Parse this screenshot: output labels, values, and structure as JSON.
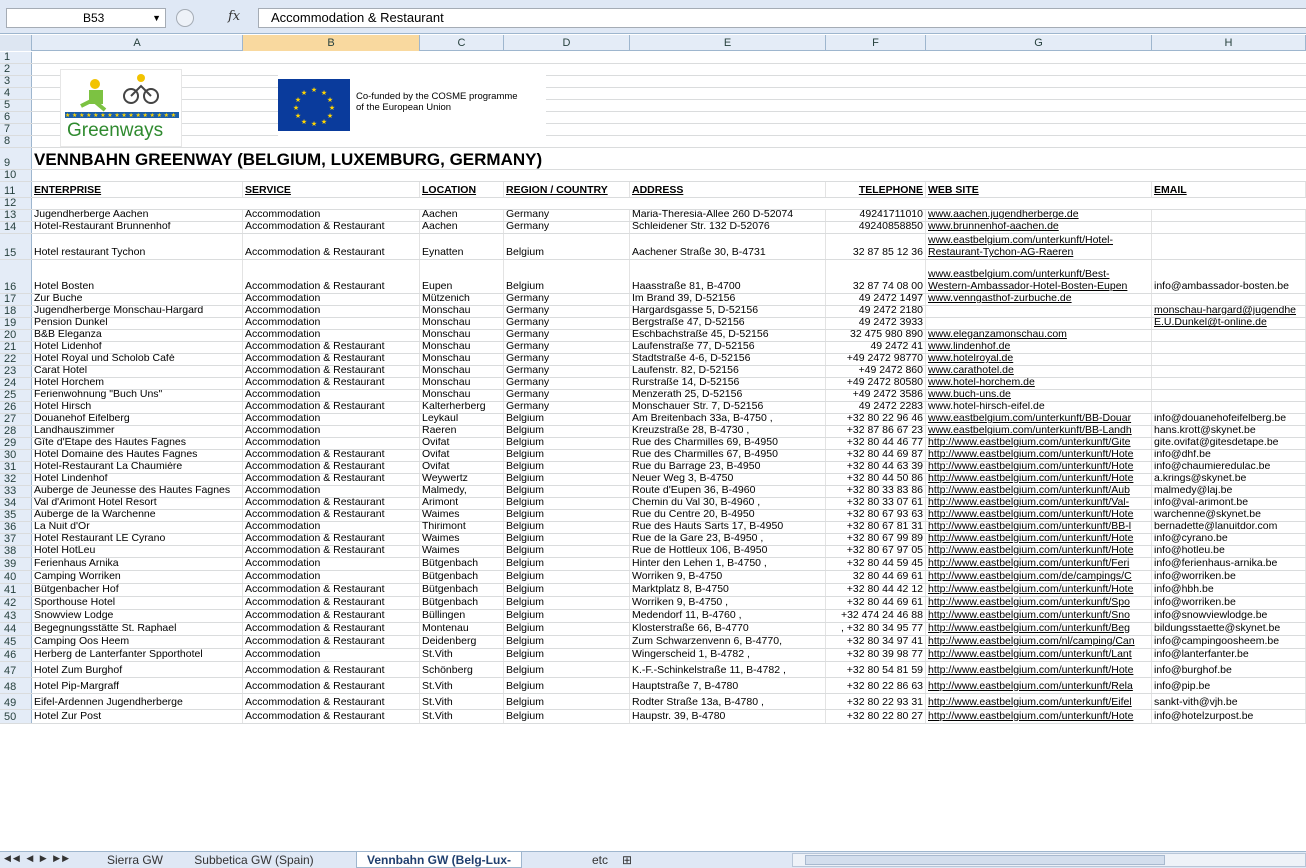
{
  "formula_bar": {
    "name_box": "B53",
    "fx": "fx",
    "value": "Accommodation & Restaurant"
  },
  "columns": [
    "A",
    "B",
    "C",
    "D",
    "E",
    "F",
    "G",
    "H"
  ],
  "selected_column": "B",
  "logo": {
    "greenways_text": "Greenways",
    "eu_text_1": "Co-funded by the COSME programme",
    "eu_text_2": "of the European Union"
  },
  "title_row": 9,
  "title": "VENNBAHN GREENWAY (BELGIUM, LUXEMBURG, GERMANY)",
  "headers": {
    "row": 11,
    "a": "ENTERPRISE",
    "b": "SERVICE",
    "c": "LOCATION",
    "d": "REGION / COUNTRY",
    "e": "ADDRESS",
    "f": "TELEPHONE",
    "g": "WEB SITE",
    "h": "EMAIL"
  },
  "empty_rows": [
    1,
    2,
    3,
    4,
    5,
    6,
    7,
    8,
    10,
    12
  ],
  "rows": [
    {
      "n": 13,
      "a": "Jugendherberge Aachen",
      "b": "Accommodation",
      "c": " Aachen",
      "d": "Germany",
      "e": "Maria-Theresia-Allee 260 D-52074",
      "f": "49241711010",
      "g": "www.aachen.jugendherberge.de",
      "h": ""
    },
    {
      "n": 14,
      "a": "Hotel-Restaurant Brunnenhof",
      "b": "Accommodation & Restaurant",
      "c": "Aachen",
      "d": "Germany",
      "e": "Schleidener Str. 132 D-52076",
      "f": "49240858850",
      "g": "www.brunnenhof-aachen.de",
      "h": ""
    },
    {
      "n": 15,
      "a": "Hotel restaurant Tychon",
      "b": "Accommodation & Restaurant",
      "c": "Eynatten",
      "d": "Belgium",
      "e": "Aachener Straße 30, B-4731",
      "f": "32 87 85 12 36",
      "g": "www.eastbelgium.com/unterkunft/Hotel-",
      "g2": "Restaurant-Tychon-AG-Raeren",
      "h": ""
    },
    {
      "n": 16,
      "a": "Hotel Bosten",
      "b": "Accommodation & Restaurant",
      "c": "Eupen",
      "d": "Belgium",
      "e": "Haasstraße 81, B-4700",
      "f": "32 87 74 08 00",
      "g": "www.eastbelgium.com/unterkunft/Best-",
      "g2": "Western-Ambassador-Hotel-Bosten-Eupen",
      "h": "info@ambassador-bosten.be"
    },
    {
      "n": 17,
      "a": "Zur Buche",
      "b": "Accommodation",
      "c": "Mützenich",
      "d": "Germany",
      "e": "Im Brand 39, D-52156",
      "f": "49 2472 1497",
      "g": "www.venngasthof-zurbuche.de",
      "h": ""
    },
    {
      "n": 18,
      "a": "Jugendherberge Monschau-Hargard",
      "b": "Accommodation",
      "c": "Monschau",
      "d": "Germany",
      "e": "Hargardsgasse 5, D-52156",
      "f": "49 2472 2180",
      "g": "",
      "h": "monschau-hargard@jugendhe"
    },
    {
      "n": 19,
      "a": "Pension Dunkel",
      "b": "Accommodation",
      "c": "Monschau",
      "d": "Germany",
      "e": "Bergstraße 47, D-52156",
      "f": "49 2472 3933",
      "g": "",
      "h": "E.U.Dunkel@t-online.de"
    },
    {
      "n": 20,
      "a": "B&B Eleganza",
      "b": "Accommodation",
      "c": "Monschau",
      "d": "Germany",
      "e": "Eschbachstraße 45, D-52156",
      "f": "32 475 980 890",
      "g": "www.eleganzamonschau.com",
      "h": ""
    },
    {
      "n": 21,
      "a": "Hotel Lidenhof",
      "b": "Accommodation & Restaurant",
      "c": "Monschau",
      "d": "Germany",
      "e": "Laufenstraße 77, D-52156",
      "f": "49 2472 41",
      "g": "www.lindenhof.de",
      "h": ""
    },
    {
      "n": 22,
      "a": "Hotel Royal und Scholob Café",
      "b": "Accommodation & Restaurant",
      "c": "Monschau",
      "d": "Germany",
      "e": "Stadtstraße 4-6, D-52156",
      "f": "+49 2472 98770",
      "g": " www.hotelroyal.de",
      "h": ""
    },
    {
      "n": 23,
      "a": "Carat Hotel",
      "b": "Accommodation & Restaurant",
      "c": "Monschau",
      "d": "Germany",
      "e": "Laufenstr. 82, D-52156",
      "f": "+49 2472 860",
      "g": " www.carathotel.de",
      "h": ""
    },
    {
      "n": 24,
      "a": "Hotel Horchem",
      "b": "Accommodation & Restaurant",
      "c": "Monschau",
      "d": "Germany",
      "e": "Rurstraße 14, D-52156",
      "f": "+49 2472 80580",
      "g": "www.hotel-horchem.de",
      "h": ""
    },
    {
      "n": 25,
      "a": "Ferienwohnung \"Buch Uns\"",
      "b": "Accommodation",
      "c": "Monschau",
      "d": "Germany",
      "e": "Menzerath 25, D-52156",
      "f": "+49 2472 3586",
      "g": "www.buch-uns.de",
      "h": ""
    },
    {
      "n": 26,
      "a": "Hotel Hirsch",
      "b": "Accommodation & Restaurant",
      "c": "Kalterherberg",
      "d": "Germany",
      "e": "Monschauer Str. 7, D-52156",
      "f": "49 2472 2283",
      "g": "www.hotel-hirsch-eifel.de",
      "h": ""
    },
    {
      "n": 27,
      "a": "Douanehof Eifelberg",
      "b": "Accommodation",
      "c": "Leykaul",
      "d": "Belgium",
      "e": "Am Breitenbach 33a, B-4750 ,",
      "f": "+32 80 22 96 46",
      "g": "www.eastbelgium.com/unterkunft/BB-Douar",
      "h": "info@douanehofeifelberg.be"
    },
    {
      "n": 28,
      "a": "Landhauszimmer",
      "b": "Accommodation",
      "c": "Raeren",
      "d": "Belgium",
      "e": "Kreuzstraße 28, B-4730 ,",
      "f": "+32 87 86 67 23",
      "g": "www.eastbelgium.com/unterkunft/BB-Landh",
      "h": "hans.krott@skynet.be"
    },
    {
      "n": 29,
      "a": "Gîte d'Etape des Hautes Fagnes",
      "b": "Accommodation",
      "c": "Ovifat",
      "d": "Belgium",
      "e": "Rue des Charmilles 69, B-4950",
      "f": "+32 80 44 46 77",
      "g": "http://www.eastbelgium.com/unterkunft/Gite",
      "h": "gite.ovifat@gitesdetape.be"
    },
    {
      "n": 30,
      "a": "Hotel Domaine des Hautes Fagnes",
      "b": "Accommodation & Restaurant",
      "c": "Ovifat",
      "d": "Belgium",
      "e": "Rue des Charmilles 67, B-4950",
      "f": "+32 80 44 69 87",
      "g": "http://www.eastbelgium.com/unterkunft/Hote",
      "h": "info@dhf.be"
    },
    {
      "n": 31,
      "a": "Hotel-Restaurant La Chaumière",
      "b": "Accommodation & Restaurant",
      "c": "Ovifat",
      "d": "Belgium",
      "e": "Rue du Barrage 23, B-4950",
      "f": "+32 80 44 63 39",
      "g": "http://www.eastbelgium.com/unterkunft/Hote",
      "h": "info@chaumieredulac.be"
    },
    {
      "n": 32,
      "a": "Hotel Lindenhof",
      "b": "Accommodation & Restaurant",
      "c": "Weywertz",
      "d": "Belgium",
      "e": "Neuer Weg 3, B-4750",
      "f": "+32 80 44 50 86",
      "g": "http://www.eastbelgium.com/unterkunft/Hote",
      "h": "a.krings@skynet.be"
    },
    {
      "n": 33,
      "a": "Auberge de Jeunesse des Hautes Fagnes",
      "b": "Accommodation",
      "c": "Malmedy,",
      "d": "Belgium",
      "e": "Route d'Eupen 36, B-4960",
      "f": "+32 80 33 83 86",
      "g": "http://www.eastbelgium.com/unterkunft/Aub",
      "h": "malmedy@laj.be"
    },
    {
      "n": 34,
      "a": "Val d'Arimont Hotel Resort",
      "b": "Accommodation & Restaurant",
      "c": "Arimont",
      "d": "Belgium",
      "e": "Chemin du Val 30, B-4960 ,",
      "f": "+32 80 33 07 61",
      "g": "http://www.eastbelgium.com/unterkunft/Val-",
      "h": "info@val-arimont.be"
    },
    {
      "n": 35,
      "a": "Auberge de la Warchenne",
      "b": "Accommodation & Restaurant",
      "c": "Waimes",
      "d": "Belgium",
      "e": "Rue du Centre 20, B-4950",
      "f": "+32 80 67 93 63",
      "g": "http://www.eastbelgium.com/unterkunft/Hote",
      "h": "warchenne@skynet.be"
    },
    {
      "n": 36,
      "a": "La Nuit d'Or",
      "b": "Accommodation",
      "c": "Thirimont",
      "d": "Belgium",
      "e": "Rue des Hauts Sarts 17, B-4950",
      "f": "+32 80 67 81 31",
      "g": "http://www.eastbelgium.com/unterkunft/BB-l",
      "h": "bernadette@lanuitdor.com"
    },
    {
      "n": 37,
      "a": "Hotel Restaurant LE Cyrano",
      "b": "Accommodation & Restaurant",
      "c": "Waimes",
      "d": "Belgium",
      "e": "Rue de la Gare 23, B-4950 ,",
      "f": "+32 80 67 99 89",
      "g": "http://www.eastbelgium.com/unterkunft/Hote",
      "h": "info@cyrano.be"
    },
    {
      "n": 38,
      "a": "Hotel HotLeu",
      "b": "Accommodation & Restaurant",
      "c": "Waimes",
      "d": "Belgium",
      "e": "Rue de Hottleux 106, B-4950",
      "f": "+32 80 67 97 05",
      "g": "http://www.eastbelgium.com/unterkunft/Hote",
      "h": "info@hotleu.be"
    },
    {
      "n": 39,
      "a": "Ferienhaus Arnika",
      "b": "Accommodation",
      "c": "Bütgenbach",
      "d": "Belgium",
      "e": "Hinter den Lehen 1, B-4750 ,",
      "f": "+32 80 44 59 45",
      "g": "http://www.eastbelgium.com/unterkunft/Feri",
      "h": "info@ferienhaus-arnika.be"
    },
    {
      "n": 40,
      "a": "Camping Worriken",
      "b": "Accommodation",
      "c": "Bütgenbach",
      "d": "Belgium",
      "e": "Worriken 9, B-4750",
      "f": "32 80 44 69 61",
      "g": "http://www.eastbelgium.com/de/campings/C",
      "h": "info@worriken.be"
    },
    {
      "n": 41,
      "a": "Bütgenbacher Hof",
      "b": "Accommodation & Restaurant",
      "c": "Bütgenbach",
      "d": "Belgium",
      "e": "Marktplatz 8, B-4750",
      "f": "+32 80 44 42 12",
      "g": "http://www.eastbelgium.com/unterkunft/Hote",
      "h": "info@hbh.be"
    },
    {
      "n": 42,
      "a": "Sporthouse Hotel",
      "b": "Accommodation & Restaurant",
      "c": "Bütgenbach",
      "d": "Belgium",
      "e": "Worriken 9, B-4750 ,",
      "f": "+32 80 44 69 61",
      "g": "http://www.eastbelgium.com/unterkunft/Spo",
      "h": "info@worriken.be"
    },
    {
      "n": 43,
      "a": "Snowview Lodge",
      "b": "Accommodation & Restaurant",
      "c": "Büllingen",
      "d": "Belgium",
      "e": "Medendorf 11, B-4760 ,",
      "f": "+32 474 24 46 88",
      "g": "http://www.eastbelgium.com/unterkunft/Sno",
      "h": "info@snowviewlodge.be"
    },
    {
      "n": 44,
      "a": "Begegnungsstätte St. Raphael",
      "b": "Accommodation & Restaurant",
      "c": "Montenau",
      "d": "Belgium",
      "e": "Klosterstraße 66, B-4770",
      "f": ", +32 80 34 95 77",
      "g": "http://www.eastbelgium.com/unterkunft/Beg",
      "h": "bildungsstaette@skynet.be"
    },
    {
      "n": 45,
      "a": "Camping Oos Heem",
      "b": "Accommodation & Restaurant",
      "c": " Deidenberg",
      "d": "Belgium",
      "e": "Zum Schwarzenvenn 6, B-4770,",
      "f": "+32 80 34 97 41",
      "g": "http://www.eastbelgium.com/nl/camping/Can",
      "h": "info@campingoosheem.be"
    },
    {
      "n": 46,
      "a": "Herberg de Lanterfanter Spporthotel",
      "b": "Accommodation",
      "c": "St.Vith",
      "d": "Belgium",
      "e": "Wingerscheid 1, B-4782 ,",
      "f": "+32 80 39 98 77",
      "g": "http://www.eastbelgium.com/unterkunft/Lant",
      "h": "info@lanterfanter.be"
    },
    {
      "n": 47,
      "a": "Hotel Zum Burghof",
      "b": "Accommodation & Restaurant",
      "c": "Schönberg",
      "d": "Belgium",
      "e": "K.-F.-Schinkelstraße 11, B-4782 ,",
      "f": "+32 80 54 81 59",
      "g": "http://www.eastbelgium.com/unterkunft/Hote",
      "h": "info@burghof.be"
    },
    {
      "n": 48,
      "a": "Hotel Pip-Margraff",
      "b": "Accommodation & Restaurant",
      "c": "St.Vith",
      "d": "Belgium",
      "e": "Hauptstraße 7, B-4780",
      "f": "+32 80 22 86 63",
      "g": "http://www.eastbelgium.com/unterkunft/Rela",
      "h": "info@pip.be"
    },
    {
      "n": 49,
      "a": "Eifel-Ardennen Jugendherberge",
      "b": "Accommodation & Restaurant",
      "c": "St.Vith",
      "d": "Belgium",
      "e": "Rodter Straße 13a, B-4780 ,",
      "f": "+32 80 22 93 31",
      "g": "http://www.eastbelgium.com/unterkunft/Eifel",
      "h": "sankt-vith@vjh.be"
    },
    {
      "n": 50,
      "a": "Hotel Zur Post",
      "b": "Accommodation & Restaurant",
      "c": "St.Vith",
      "d": "Belgium",
      "e": "Haupstr. 39, B-4780",
      "f": "+32 80 22 80 27",
      "g": "http://www.eastbelgium.com/unterkunft/Hote",
      "h": "info@hotelzurpost.be"
    }
  ],
  "sheet_tabs": [
    {
      "label": "Sierra GW (Spain)",
      "active": false
    },
    {
      "label": "Subbetica GW (Spain)",
      "active": false
    },
    {
      "label": "Vennbahn GW (Belg-Lux-Germ)",
      "active": true
    },
    {
      "label": "etc",
      "active": false
    }
  ],
  "colors": {
    "accent": "#dfe8f5",
    "selected_header": "#f9d99f",
    "grid": "#dadcdd"
  }
}
